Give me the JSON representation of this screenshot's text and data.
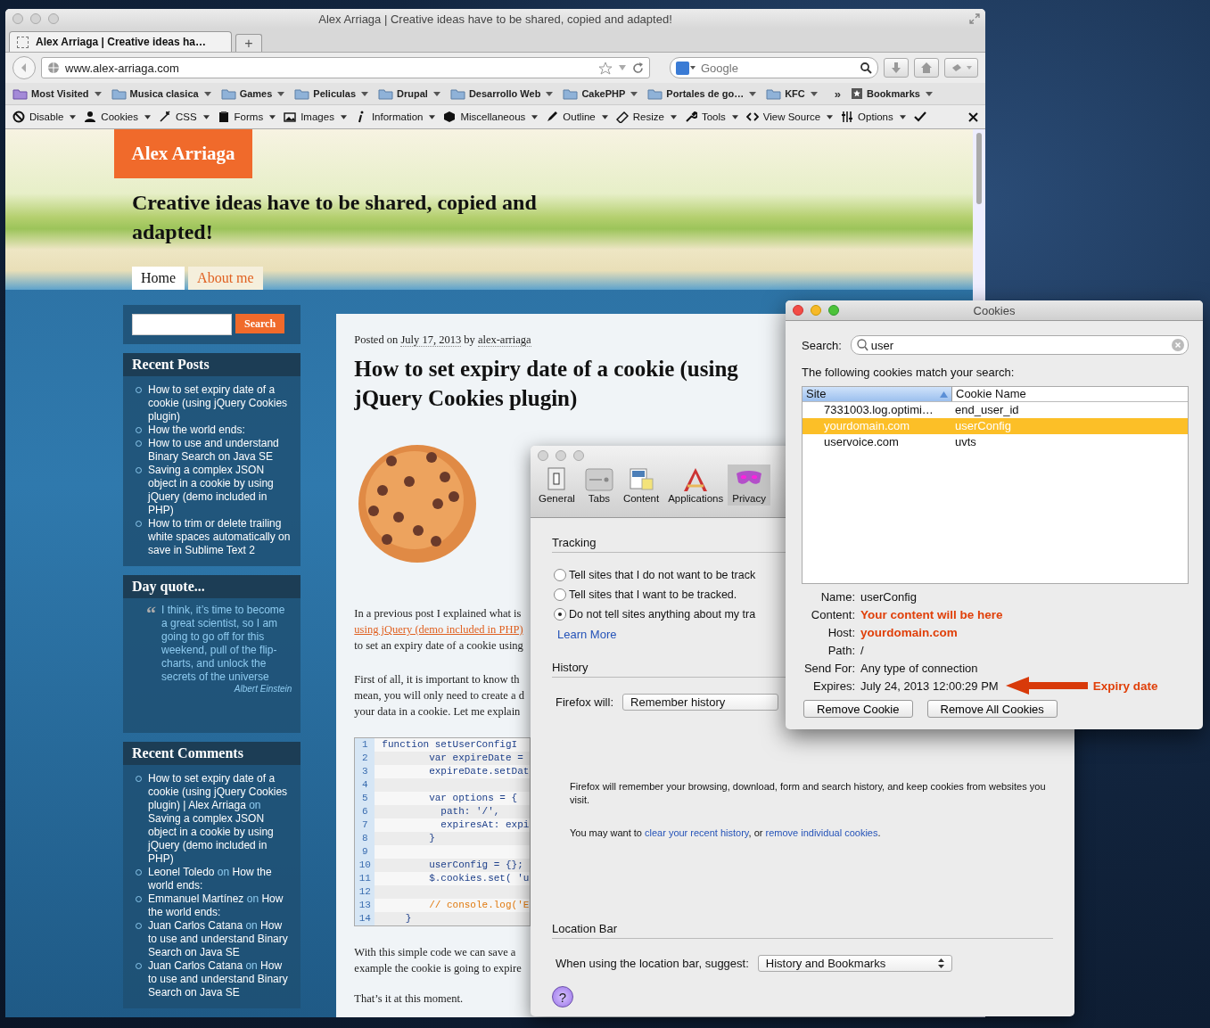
{
  "browser": {
    "window_title": "Alex Arriaga | Creative ideas have to be shared, copied and adapted!",
    "tabs": [
      {
        "label": "Alex Arriaga | Creative ideas ha…",
        "selected": true
      }
    ],
    "new_tab": "+",
    "url": "www.alex-arriaga.com",
    "search": {
      "placeholder": "Google"
    },
    "bookmarks": [
      {
        "label": "Most Visited",
        "kind": "smart"
      },
      {
        "label": "Musica clasica",
        "kind": "folder"
      },
      {
        "label": "Games",
        "kind": "folder"
      },
      {
        "label": "Peliculas",
        "kind": "folder"
      },
      {
        "label": "Drupal",
        "kind": "folder"
      },
      {
        "label": "Desarrollo Web",
        "kind": "folder"
      },
      {
        "label": "CakePHP",
        "kind": "folder"
      },
      {
        "label": "Portales de go…",
        "kind": "folder"
      },
      {
        "label": "KFC",
        "kind": "folder"
      },
      {
        "label": "»",
        "kind": "overflow"
      },
      {
        "label": "Bookmarks",
        "kind": "menu"
      }
    ],
    "dev_toolbar": [
      "Disable",
      "Cookies",
      "CSS",
      "Forms",
      "Images",
      "Information",
      "Miscellaneous",
      "Outline",
      "Resize",
      "Tools",
      "View Source",
      "Options"
    ]
  },
  "site": {
    "logo": "Alex Arriaga",
    "tagline": "Creative ideas have to be shared, copied and adapted!",
    "nav": [
      {
        "label": "Home",
        "selected": true
      },
      {
        "label": "About me",
        "selected": false
      }
    ],
    "search_button": "Search",
    "recent_posts": {
      "title": "Recent Posts",
      "items": [
        "How to set expiry date of a cookie (using jQuery Cookies plugin)",
        "How the world ends:",
        "How to use and understand Binary Search on Java SE",
        "Saving a complex JSON object in a cookie by using jQuery (demo included in PHP)",
        "How to trim or delete trailing white spaces automatically on save in Sublime Text 2"
      ]
    },
    "day_quote": {
      "title": "Day quote...",
      "mark": "“",
      "quote": "I think, it’s time to become a great scientist, so I am going to go off for this weekend, pull of the flip-charts, and unlock the secrets of the universe",
      "author": "Albert Einstein"
    },
    "recent_comments": {
      "title": "Recent Comments",
      "items": [
        {
          "author": "How to set expiry date of a cookie (using jQuery Cookies plugin) | Alex Arriaga",
          "on": "on",
          "post": "Saving a complex JSON object in a cookie by using jQuery (demo included in PHP)"
        },
        {
          "author": "Leonel Toledo",
          "on": "on",
          "post": "How the world ends:"
        },
        {
          "author": "Emmanuel Martínez",
          "on": "on",
          "post": "How the world ends:"
        },
        {
          "author": "Juan Carlos Catana",
          "on": "on",
          "post": "How to use and understand Binary Search on Java SE"
        },
        {
          "author": "Juan Carlos Catana",
          "on": "on",
          "post": "How to use and understand Binary Search on Java SE"
        }
      ]
    },
    "post": {
      "posted_on": "Posted on",
      "date": "July 17, 2013",
      "by": "by",
      "author": "alex-arriaga",
      "title": "How to set expiry date of a cookie (using jQuery Cookies plugin)",
      "paragraph_1": [
        {
          "text": "In a previous post I explained what is",
          "link": false
        },
        {
          "text": "using jQuery (demo included in PHP)",
          "link": true
        },
        {
          "text": "to set an expiry date of a cookie using",
          "link": false
        }
      ],
      "paragraph_2": [
        {
          "text": "First of all, it is important to know th",
          "link": false
        },
        {
          "text": "mean, you will only need to create a d",
          "link": false
        },
        {
          "text": "your data in a cookie. Let me explain",
          "link": false
        }
      ],
      "code": [
        {
          "number": "1",
          "code": "function setUserConfigI",
          "kind": "code"
        },
        {
          "number": "2",
          "code": "        var expireDate =",
          "kind": "code"
        },
        {
          "number": "3",
          "code": "        expireDate.setDat",
          "kind": "code"
        },
        {
          "number": "4",
          "kind": "blank"
        },
        {
          "number": "5",
          "code": "        var options = {",
          "kind": "code"
        },
        {
          "number": "6",
          "code": "          path: '/',",
          "kind": "code"
        },
        {
          "number": "7",
          "code": "          expiresAt: expi",
          "kind": "code"
        },
        {
          "number": "8",
          "code": "        }",
          "kind": "code"
        },
        {
          "number": "9",
          "kind": "blank"
        },
        {
          "number": "10",
          "code": "        userConfig = {};",
          "kind": "code"
        },
        {
          "number": "11",
          "code": "        $.cookies.set( 'u",
          "kind": "code"
        },
        {
          "number": "12",
          "kind": "blank"
        },
        {
          "number": "13",
          "code": "        // console.log('E",
          "kind": "comment"
        },
        {
          "number": "14",
          "code": "    }",
          "kind": "code"
        }
      ],
      "paragraph_3": [
        {
          "text": "With this simple code we can save a",
          "link": false
        },
        {
          "text": "example the cookie is going to expire",
          "link": false
        }
      ],
      "closing": "That’s it at this moment."
    }
  },
  "preferences": {
    "toolbar": [
      {
        "label": "General",
        "selected": false
      },
      {
        "label": "Tabs",
        "selected": false
      },
      {
        "label": "Content",
        "selected": false
      },
      {
        "label": "Applications",
        "selected": false
      },
      {
        "label": "Privacy",
        "selected": true
      }
    ],
    "tracking": {
      "title": "Tracking",
      "options": [
        {
          "label": "Tell sites that I do not want to be track",
          "selected": false
        },
        {
          "label": "Tell sites that I want to be tracked.",
          "selected": false
        },
        {
          "label": "Do not tell sites anything about my tra",
          "selected": true
        }
      ],
      "learn_more": "Learn More"
    },
    "history": {
      "title": "History",
      "label": "Firefox will:",
      "value": "Remember history",
      "description": "Firefox will remember your browsing, download, form and search history, and keep cookies from websites you visit.",
      "hint_before": "You may want to",
      "link_1": "clear your recent history",
      "hint_middle": ", or",
      "link_2": "remove individual cookies",
      "hint_after": "."
    },
    "location_bar": {
      "title": "Location Bar",
      "label": "When using the location bar, suggest:",
      "value": "History and Bookmarks"
    },
    "help": "?"
  },
  "cookies": {
    "title": "Cookies",
    "search_label": "Search:",
    "search_value": "user",
    "match_text": "The following cookies match your search:",
    "columns": [
      "Site",
      "Cookie Name"
    ],
    "rows": [
      {
        "site": "7331003.log.optimi…",
        "name": "end_user_id",
        "selected": false
      },
      {
        "site": "yourdomain.com",
        "name": "userConfig",
        "selected": true
      },
      {
        "site": "uservoice.com",
        "name": "uvts",
        "selected": false
      }
    ],
    "details": [
      {
        "label": "Name:",
        "value": "userConfig",
        "highlight": false
      },
      {
        "label": "Content:",
        "value": "Your content will be here",
        "highlight": true
      },
      {
        "label": "Host:",
        "value": "yourdomain.com",
        "highlight": true
      },
      {
        "label": "Path:",
        "value": "/",
        "highlight": false
      },
      {
        "label": "Send For:",
        "value": "Any type of connection",
        "highlight": false
      },
      {
        "label": "Expires:",
        "value": "July 24, 2013 12:00:29 PM",
        "highlight": false,
        "annotation": "Expiry date"
      }
    ],
    "buttons": [
      "Remove Cookie",
      "Remove All Cookies"
    ]
  }
}
